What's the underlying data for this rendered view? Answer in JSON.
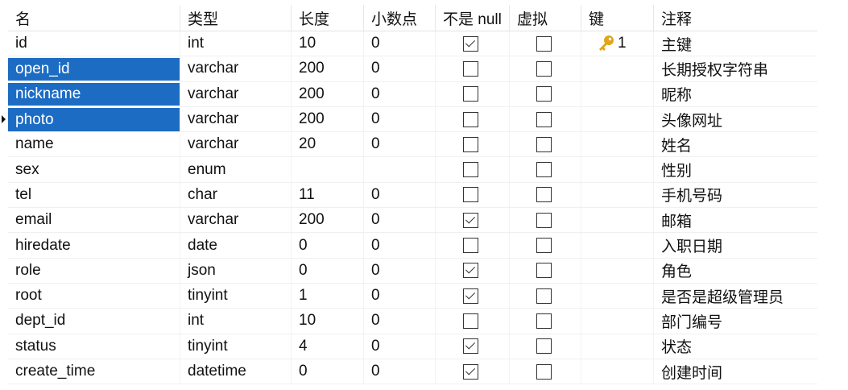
{
  "columns": {
    "name": "名",
    "type": "类型",
    "length": "长度",
    "decimals": "小数点",
    "not_null": "不是 null",
    "virtual": "虚拟",
    "key": "键",
    "comment": "注释"
  },
  "colors": {
    "selection": "#1d6cc4",
    "key": "#e0a51a"
  },
  "rows": [
    {
      "name": "id",
      "type": "int",
      "length": "10",
      "decimals": "0",
      "not_null": true,
      "virtual": false,
      "key": "1",
      "comment": "主键",
      "selected": false
    },
    {
      "name": "open_id",
      "type": "varchar",
      "length": "200",
      "decimals": "0",
      "not_null": false,
      "virtual": false,
      "key": "",
      "comment": "长期授权字符串",
      "selected": true
    },
    {
      "name": "nickname",
      "type": "varchar",
      "length": "200",
      "decimals": "0",
      "not_null": false,
      "virtual": false,
      "key": "",
      "comment": "昵称",
      "selected": true
    },
    {
      "name": "photo",
      "type": "varchar",
      "length": "200",
      "decimals": "0",
      "not_null": false,
      "virtual": false,
      "key": "",
      "comment": "头像网址",
      "selected": true,
      "current": true
    },
    {
      "name": "name",
      "type": "varchar",
      "length": "20",
      "decimals": "0",
      "not_null": false,
      "virtual": false,
      "key": "",
      "comment": "姓名",
      "selected": false
    },
    {
      "name": "sex",
      "type": "enum",
      "length": "",
      "decimals": "",
      "not_null": false,
      "virtual": false,
      "key": "",
      "comment": "性别",
      "selected": false
    },
    {
      "name": "tel",
      "type": "char",
      "length": "11",
      "decimals": "0",
      "not_null": false,
      "virtual": false,
      "key": "",
      "comment": "手机号码",
      "selected": false
    },
    {
      "name": "email",
      "type": "varchar",
      "length": "200",
      "decimals": "0",
      "not_null": true,
      "virtual": false,
      "key": "",
      "comment": "邮箱",
      "selected": false
    },
    {
      "name": "hiredate",
      "type": "date",
      "length": "0",
      "decimals": "0",
      "not_null": false,
      "virtual": false,
      "key": "",
      "comment": "入职日期",
      "selected": false
    },
    {
      "name": "role",
      "type": "json",
      "length": "0",
      "decimals": "0",
      "not_null": true,
      "virtual": false,
      "key": "",
      "comment": "角色",
      "selected": false
    },
    {
      "name": "root",
      "type": "tinyint",
      "length": "1",
      "decimals": "0",
      "not_null": true,
      "virtual": false,
      "key": "",
      "comment": "是否是超级管理员",
      "selected": false
    },
    {
      "name": "dept_id",
      "type": "int",
      "length": "10",
      "decimals": "0",
      "not_null": false,
      "virtual": false,
      "key": "",
      "comment": "部门编号",
      "selected": false
    },
    {
      "name": "status",
      "type": "tinyint",
      "length": "4",
      "decimals": "0",
      "not_null": true,
      "virtual": false,
      "key": "",
      "comment": "状态",
      "selected": false
    },
    {
      "name": "create_time",
      "type": "datetime",
      "length": "0",
      "decimals": "0",
      "not_null": true,
      "virtual": false,
      "key": "",
      "comment": "创建时间",
      "selected": false
    }
  ]
}
